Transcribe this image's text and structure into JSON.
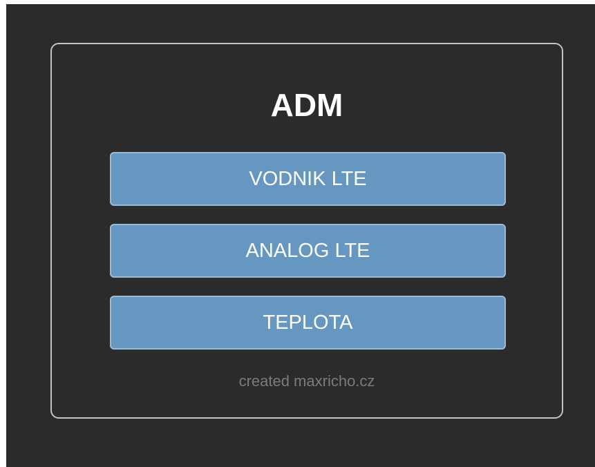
{
  "card": {
    "title": "ADM",
    "buttons": [
      {
        "label": "VODNIK LTE"
      },
      {
        "label": "ANALOG LTE"
      },
      {
        "label": "TEPLOTA"
      }
    ],
    "footer": "created maxricho.cz"
  },
  "colors": {
    "background": "#2b2b2b",
    "card_border": "#c4c4c4",
    "button_fill": "#6697c1",
    "button_border": "#9bbbd7",
    "title_text": "#ffffff",
    "footer_text": "#7b7b7b"
  }
}
